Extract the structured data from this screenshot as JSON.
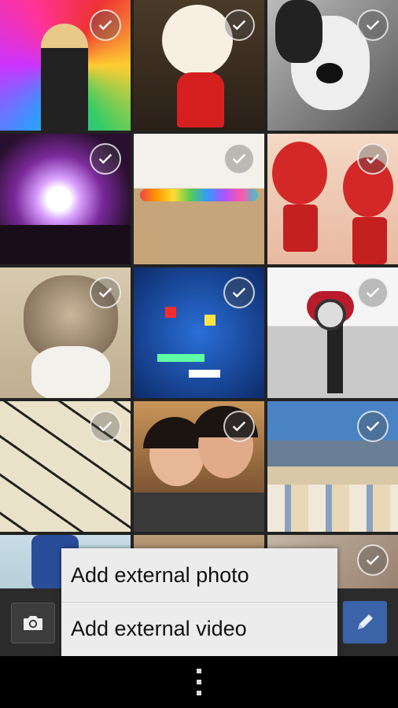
{
  "photos": [
    {
      "subject": "woman-triangle-wall",
      "selected": false
    },
    {
      "subject": "bun-mascot-figure",
      "selected": false
    },
    {
      "subject": "dog-portrait",
      "selected": false
    },
    {
      "subject": "concert-stage-lights",
      "selected": false
    },
    {
      "subject": "colorful-bean-bags",
      "selected": false
    },
    {
      "subject": "red-mushroom-toys",
      "selected": false
    },
    {
      "subject": "tabby-cat",
      "selected": false
    },
    {
      "subject": "pixel-led-display",
      "selected": false
    },
    {
      "subject": "motorcycle",
      "selected": false
    },
    {
      "subject": "alphabet-letters",
      "selected": false
    },
    {
      "subject": "two-girls-smiling",
      "selected": false
    },
    {
      "subject": "city-view",
      "selected": false
    },
    {
      "subject": "person-blue-dress",
      "selected": false
    },
    {
      "subject": "room-interior",
      "selected": false
    },
    {
      "subject": "abstract-colors",
      "selected": false
    }
  ],
  "menu": {
    "add_external_photo": "Add external photo",
    "add_external_video": "Add external video"
  },
  "toolbar": {
    "camera_icon": "camera-icon",
    "edit_icon": "pencil-icon",
    "edit_color": "#3a63a8"
  },
  "navbar": {
    "overflow_icon": "overflow-menu-icon"
  }
}
